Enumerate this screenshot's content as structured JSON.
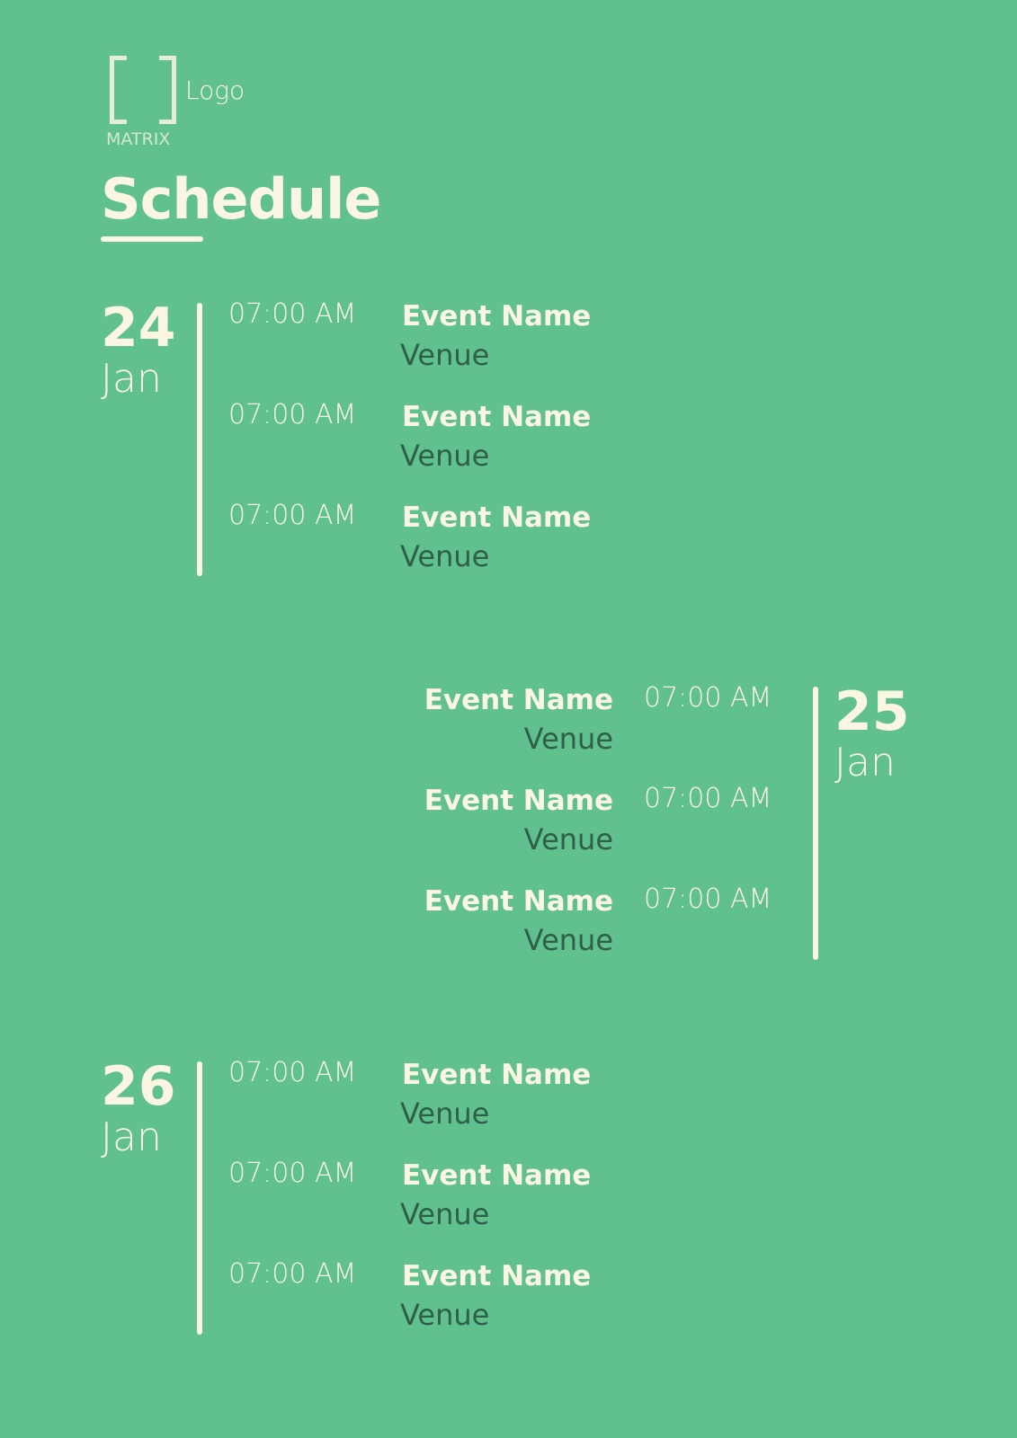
{
  "logo": {
    "text": "Logo",
    "subtext": "MATRIX"
  },
  "title": "Schedule",
  "days": [
    {
      "day": "24",
      "month": "Jan",
      "events": [
        {
          "time": "07:00 AM",
          "name": "Event Name",
          "venue": "Venue"
        },
        {
          "time": "07:00 AM",
          "name": "Event Name",
          "venue": "Venue"
        },
        {
          "time": "07:00 AM",
          "name": "Event Name",
          "venue": "Venue"
        }
      ]
    },
    {
      "day": "25",
      "month": "Jan",
      "events": [
        {
          "time": "07:00 AM",
          "name": "Event Name",
          "venue": "Venue"
        },
        {
          "time": "07:00 AM",
          "name": "Event Name",
          "venue": "Venue"
        },
        {
          "time": "07:00 AM",
          "name": "Event Name",
          "venue": "Venue"
        }
      ]
    },
    {
      "day": "26",
      "month": "Jan",
      "events": [
        {
          "time": "07:00 AM",
          "name": "Event Name",
          "venue": "Venue"
        },
        {
          "time": "07:00 AM",
          "name": "Event Name",
          "venue": "Venue"
        },
        {
          "time": "07:00 AM",
          "name": "Event Name",
          "venue": "Venue"
        }
      ]
    }
  ]
}
